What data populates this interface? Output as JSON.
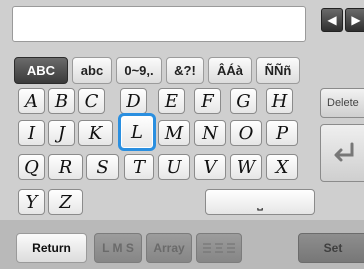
{
  "input": {
    "value": ""
  },
  "nav": {
    "left_icon": "arrow-left-icon",
    "right_icon": "arrow-right-icon",
    "left_glyph": "◀",
    "right_glyph": "▶"
  },
  "tabs": [
    {
      "label": "ABC",
      "active": true
    },
    {
      "label": "abc",
      "active": false
    },
    {
      "label": "0~9,.",
      "active": false
    },
    {
      "label": "&?!",
      "active": false
    },
    {
      "label": "ÂÁà",
      "active": false
    },
    {
      "label": "ÑÑñ",
      "active": false
    }
  ],
  "keys": {
    "row1": [
      "A",
      "B",
      "C",
      "D",
      "E",
      "F",
      "G",
      "H"
    ],
    "row2": [
      "I",
      "J",
      "K",
      "L",
      "M",
      "N",
      "O",
      "P"
    ],
    "row3": [
      "Q",
      "R",
      "S",
      "T",
      "U",
      "V",
      "W",
      "X"
    ],
    "row4": [
      "Y",
      "Z"
    ],
    "selected": "L"
  },
  "delete_label": "Delete",
  "space_icon": "space-icon",
  "space_glyph": "⎵",
  "enter_icon": "enter-arrow-icon",
  "bottom": {
    "return_label": "Return",
    "lms_label": "L M S",
    "array_label": "Array",
    "align_icon": "align-icon",
    "set_label": "Set"
  },
  "colors": {
    "highlight": "#2a8fe0",
    "active_tab": "#3a3a3a"
  }
}
